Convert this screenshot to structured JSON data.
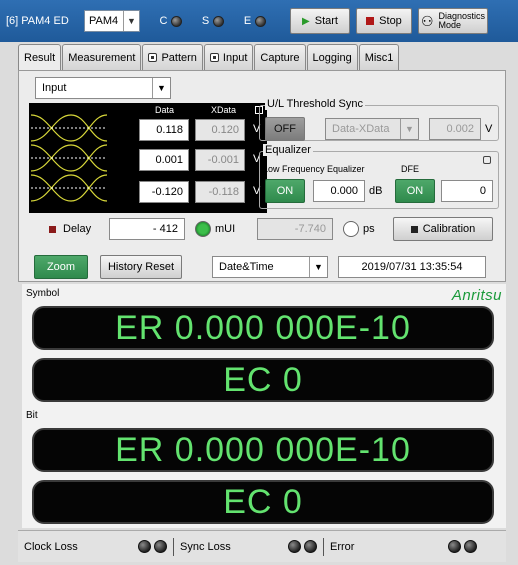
{
  "titlebar": {
    "title": "[6] PAM4 ED",
    "mode_value": "PAM4",
    "led_labels": [
      "C",
      "S",
      "E"
    ],
    "start_label": "Start",
    "stop_label": "Stop",
    "diag_line1": "Diagnostics",
    "diag_line2": "Mode"
  },
  "tabs": [
    "Result",
    "Measurement",
    "Pattern",
    "Input",
    "Capture",
    "Logging",
    "Misc1"
  ],
  "panel": {
    "input_select": "Input",
    "eye": {
      "col_data": "Data",
      "col_xdata": "XData",
      "rows": [
        {
          "data": "0.118",
          "xdata": "0.120",
          "unit": "V"
        },
        {
          "data": "0.001",
          "xdata": "-0.001",
          "unit": "V"
        },
        {
          "data": "-0.120",
          "xdata": "-0.118",
          "unit": "V"
        }
      ]
    },
    "threshold": {
      "label": "U/L Threshold Sync",
      "off_label": "OFF",
      "mode_value": "Data-XData",
      "value": "0.002",
      "unit": "V"
    },
    "equalizer": {
      "label": "Equalizer",
      "lfe_label": "Low Frequency Equalizer",
      "dfe_label": "DFE",
      "lfe_on": "ON",
      "lfe_value": "0.000",
      "lfe_unit": "dB",
      "dfe_on": "ON",
      "dfe_value": "0"
    },
    "delay": {
      "label": "Delay",
      "value": "- 412",
      "mui_unit": "mUI",
      "ps_value": "-7.740",
      "ps_unit": "ps",
      "calibration_label": "Calibration"
    }
  },
  "actions": {
    "zoom_label": "Zoom",
    "history_reset_label": "History Reset",
    "time_select": "Date&Time",
    "datetime": "2019/07/31 13:35:54"
  },
  "result": {
    "symbol_label": "Symbol",
    "brand": "Anritsu",
    "symbol_er": "ER 0.000 000E-10",
    "symbol_ec": "EC 0",
    "bit_label": "Bit",
    "bit_er": "ER 0.000 000E-10",
    "bit_ec": "EC 0"
  },
  "status": {
    "clock_loss": "Clock Loss",
    "sync_loss": "Sync Loss",
    "error": "Error"
  },
  "colors": {
    "titlebar": "#2f6fb3",
    "display_text": "#63e36f",
    "on_button": "#2f8a4c",
    "brand": "#1a9a3a"
  }
}
